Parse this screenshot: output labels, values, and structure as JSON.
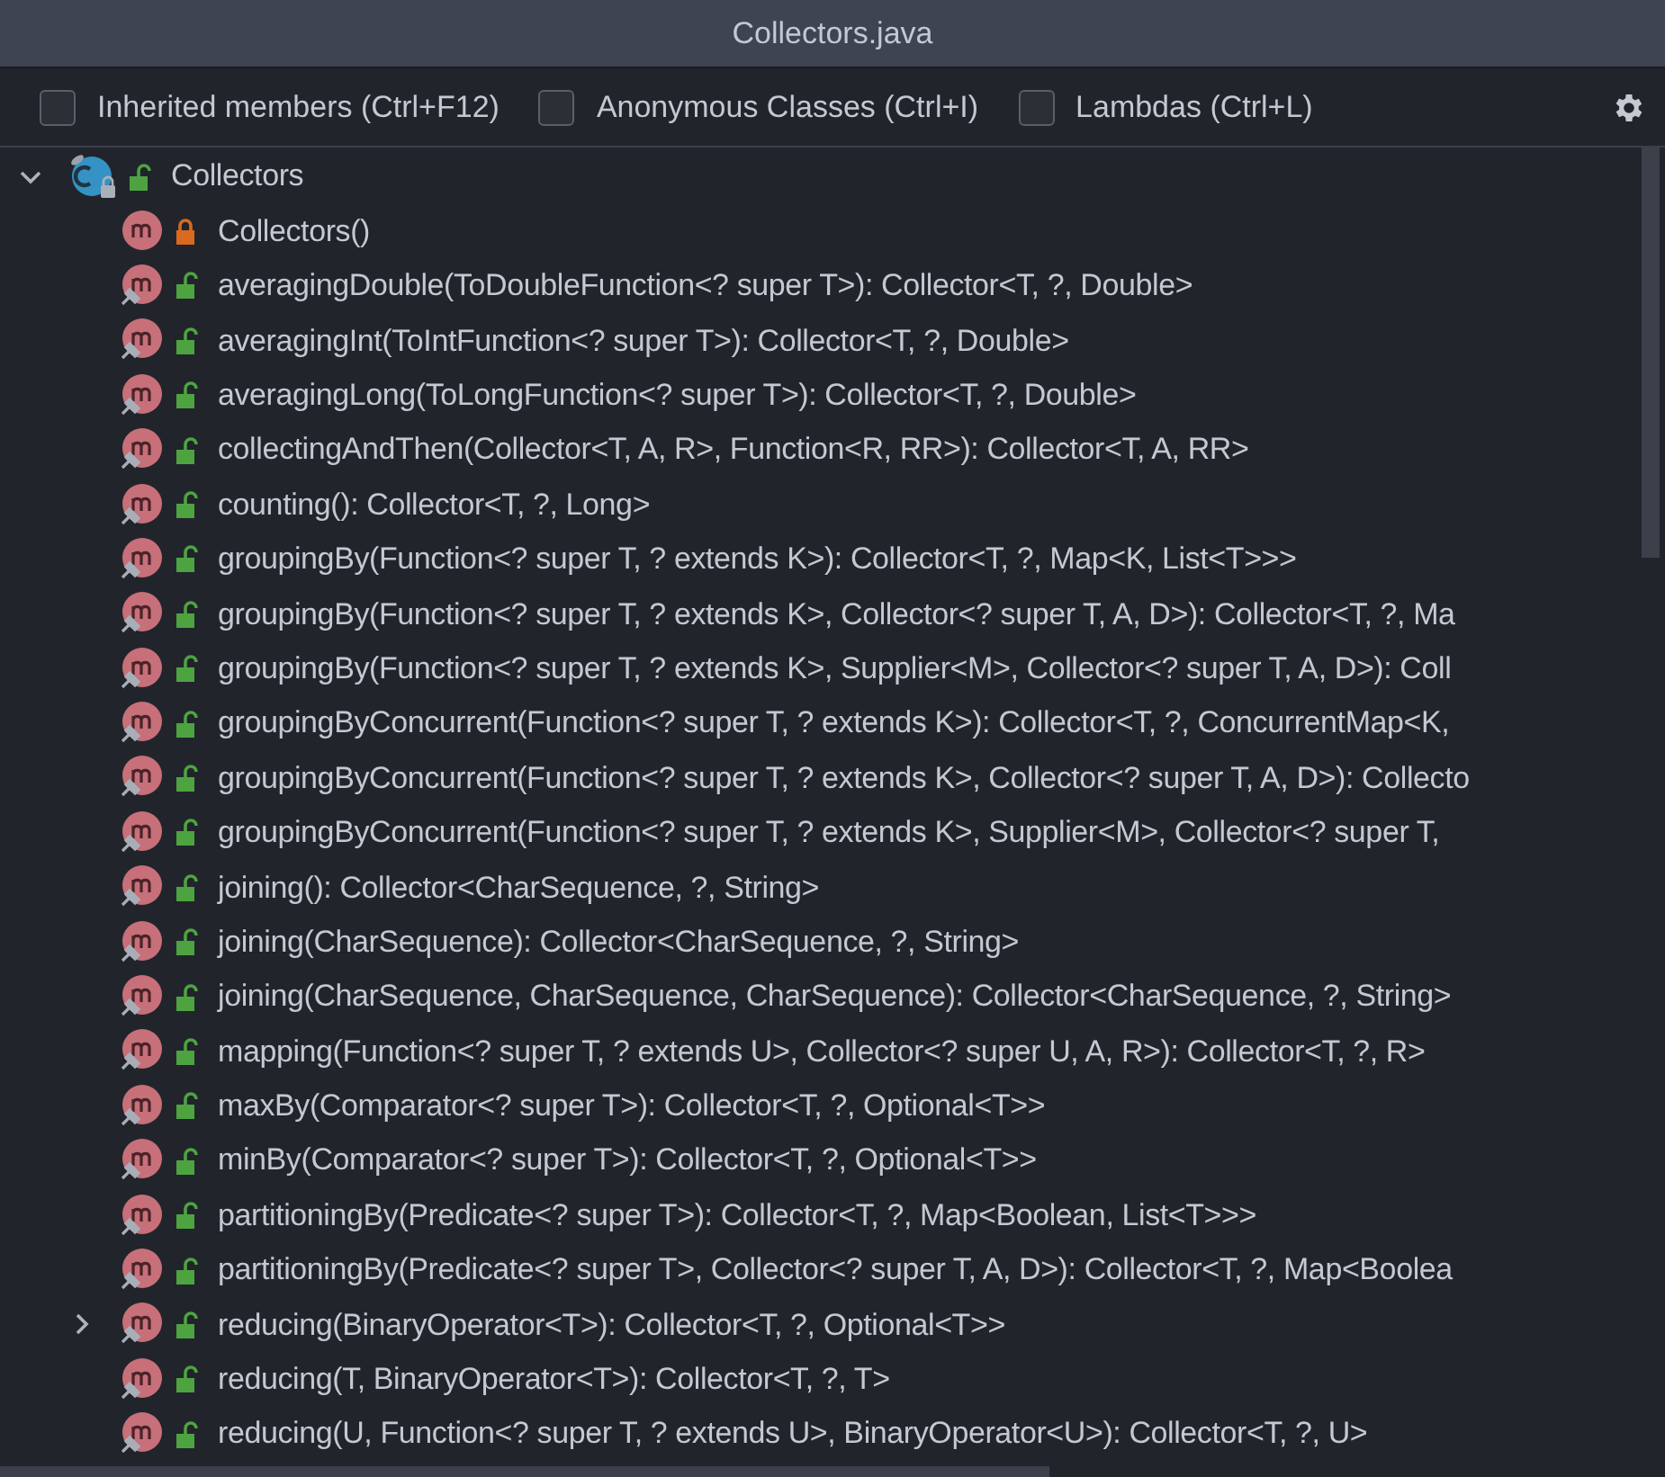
{
  "window": {
    "title": "Collectors.java"
  },
  "filters": [
    {
      "label": "Inherited members (Ctrl+F12)",
      "checked": false
    },
    {
      "label": "Anonymous Classes (Ctrl+I)",
      "checked": false
    },
    {
      "label": "Lambdas (Ctrl+L)",
      "checked": false
    }
  ],
  "tree": {
    "label": "Collectors",
    "kind": "class",
    "locked": false,
    "expanded": true,
    "children": [
      {
        "label": "Collectors()",
        "kind": "method",
        "locked": true,
        "static": false
      },
      {
        "label": "averagingDouble(ToDoubleFunction<? super T>): Collector<T, ?, Double>",
        "kind": "method",
        "locked": false,
        "static": true
      },
      {
        "label": "averagingInt(ToIntFunction<? super T>): Collector<T, ?, Double>",
        "kind": "method",
        "locked": false,
        "static": true
      },
      {
        "label": "averagingLong(ToLongFunction<? super T>): Collector<T, ?, Double>",
        "kind": "method",
        "locked": false,
        "static": true
      },
      {
        "label": "collectingAndThen(Collector<T, A, R>, Function<R, RR>): Collector<T, A, RR>",
        "kind": "method",
        "locked": false,
        "static": true
      },
      {
        "label": "counting(): Collector<T, ?, Long>",
        "kind": "method",
        "locked": false,
        "static": true
      },
      {
        "label": "groupingBy(Function<? super T, ? extends K>): Collector<T, ?, Map<K, List<T>>>",
        "kind": "method",
        "locked": false,
        "static": true
      },
      {
        "label": "groupingBy(Function<? super T, ? extends K>, Collector<? super T, A, D>): Collector<T, ?, Ma",
        "kind": "method",
        "locked": false,
        "static": true
      },
      {
        "label": "groupingBy(Function<? super T, ? extends K>, Supplier<M>, Collector<? super T, A, D>): Coll",
        "kind": "method",
        "locked": false,
        "static": true
      },
      {
        "label": "groupingByConcurrent(Function<? super T, ? extends K>): Collector<T, ?, ConcurrentMap<K,",
        "kind": "method",
        "locked": false,
        "static": true
      },
      {
        "label": "groupingByConcurrent(Function<? super T, ? extends K>, Collector<? super T, A, D>): Collecto",
        "kind": "method",
        "locked": false,
        "static": true
      },
      {
        "label": "groupingByConcurrent(Function<? super T, ? extends K>, Supplier<M>, Collector<? super T,",
        "kind": "method",
        "locked": false,
        "static": true
      },
      {
        "label": "joining(): Collector<CharSequence, ?, String>",
        "kind": "method",
        "locked": false,
        "static": true
      },
      {
        "label": "joining(CharSequence): Collector<CharSequence, ?, String>",
        "kind": "method",
        "locked": false,
        "static": true
      },
      {
        "label": "joining(CharSequence, CharSequence, CharSequence): Collector<CharSequence, ?, String>",
        "kind": "method",
        "locked": false,
        "static": true
      },
      {
        "label": "mapping(Function<? super T, ? extends U>, Collector<? super U, A, R>): Collector<T, ?, R>",
        "kind": "method",
        "locked": false,
        "static": true
      },
      {
        "label": "maxBy(Comparator<? super T>): Collector<T, ?, Optional<T>>",
        "kind": "method",
        "locked": false,
        "static": true
      },
      {
        "label": "minBy(Comparator<? super T>): Collector<T, ?, Optional<T>>",
        "kind": "method",
        "locked": false,
        "static": true
      },
      {
        "label": "partitioningBy(Predicate<? super T>): Collector<T, ?, Map<Boolean, List<T>>>",
        "kind": "method",
        "locked": false,
        "static": true
      },
      {
        "label": "partitioningBy(Predicate<? super T>, Collector<? super T, A, D>): Collector<T, ?, Map<Boolea",
        "kind": "method",
        "locked": false,
        "static": true
      },
      {
        "label": "reducing(BinaryOperator<T>): Collector<T, ?, Optional<T>>",
        "kind": "method",
        "locked": false,
        "static": true,
        "expanded": false
      },
      {
        "label": "reducing(T, BinaryOperator<T>): Collector<T, ?, T>",
        "kind": "method",
        "locked": false,
        "static": true
      },
      {
        "label": "reducing(U, Function<? super T, ? extends U>, BinaryOperator<U>): Collector<T, ?, U>",
        "kind": "method",
        "locked": false,
        "static": true
      }
    ]
  }
}
